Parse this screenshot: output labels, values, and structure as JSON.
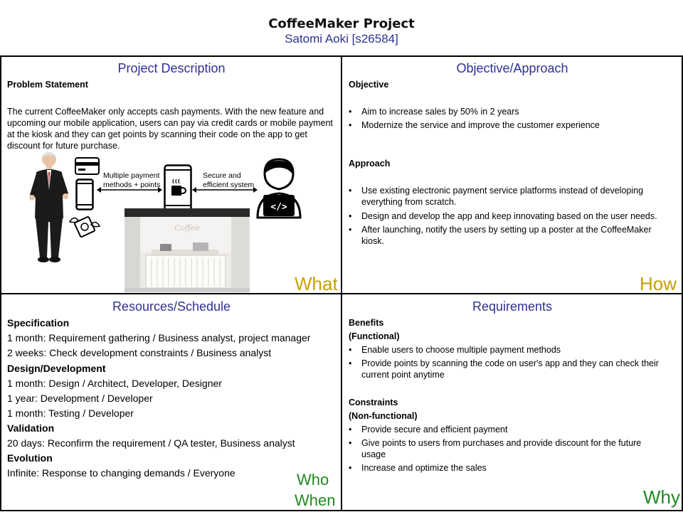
{
  "header": {
    "title": "CoffeeMaker Project",
    "subtitle": "Satomi Aoki [s26584]"
  },
  "what": {
    "heading": "Project Description",
    "problem_label": "Problem Statement",
    "problem_text": "The current CoffeeMaker only accepts cash payments. With the new feature and upcoming our mobile application, users can pay via credit cards or mobile payment at the kiosk and they can get points by scanning their code on the app to get discount for future purchase.",
    "diagram": {
      "label_left_1": "Multiple payment",
      "label_left_2": "methods + points",
      "label_right_1": "Secure and",
      "label_right_2": "efficient system",
      "kiosk_sign": "Coffee"
    },
    "corner": "What"
  },
  "how": {
    "heading": "Objective/Approach",
    "objective_label": "Objective",
    "objectives": [
      "Aim to increase sales by 50% in 2 years",
      "Modernize the service and improve the customer experience"
    ],
    "approach_label": "Approach",
    "approaches": [
      "Use existing electronic payment service platforms instead of developing everything from scratch.",
      "Design and develop the app and keep innovating based on the user needs.",
      "After launching, notify the users by setting up a poster at the CoffeeMaker kiosk."
    ],
    "corner": "How"
  },
  "who": {
    "heading": "Resources/Schedule",
    "sections": [
      {
        "label": "Specification",
        "items": [
          "1 month:  Requirement gathering / Business analyst, project manager",
          "2 weeks:  Check development constraints / Business analyst"
        ]
      },
      {
        "label": "Design/Development",
        "items": [
          "1 month: Design / Architect, Developer, Designer",
          "1 year: Development / Developer",
          "1 month: Testing / Developer"
        ]
      },
      {
        "label": "Validation",
        "items": [
          "20 days: Reconfirm the requirement / QA tester, Business analyst"
        ]
      },
      {
        "label": "Evolution",
        "items": [
          "Infinite: Response to changing demands / Everyone"
        ]
      }
    ],
    "corner_1": "Who",
    "corner_2": "When"
  },
  "why": {
    "heading": "Requirements",
    "benefits_label": "Benefits",
    "functional_label": "(Functional)",
    "benefits": [
      "Enable users to choose multiple payment methods",
      "Provide points by scanning the code on user's app and they can check their current point anytime"
    ],
    "constraints_label": "Constraints",
    "nonfunctional_label": "(Non-functional)",
    "constraints": [
      "Provide secure and efficient payment",
      "Give points to users from purchases and provide discount for the future usage",
      "Increase and optimize the sales"
    ],
    "corner": "Why"
  },
  "colors": {
    "heading": "#2e3192",
    "corner_yellow": "#c8a000",
    "corner_green": "#1f8a1f"
  }
}
